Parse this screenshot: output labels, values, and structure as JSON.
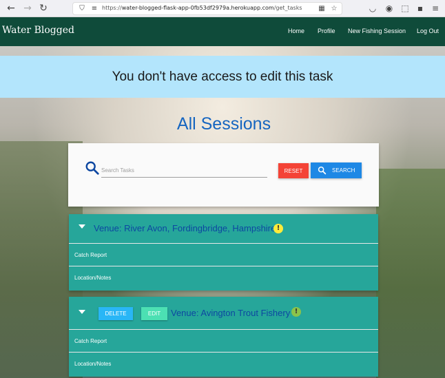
{
  "browser": {
    "url_prefix": "https://",
    "url_host": "water-blogged-flask-app-0fb53df2979a.herokuapp.com",
    "url_path": "/get_tasks"
  },
  "navbar": {
    "brand": "Water Blogged",
    "links": [
      "Home",
      "Profile",
      "New Fishing Session",
      "Log Out"
    ]
  },
  "alert": {
    "message": "You don't have access to edit this task"
  },
  "heading": "All Sessions",
  "search": {
    "placeholder": "Search Tasks",
    "reset_label": "RESET",
    "search_label": "SEARCH"
  },
  "sessions": [
    {
      "venue": "Venue: River Avon, Fordingbridge, Hampshire",
      "exclaim": "!",
      "exclaim_color": "#ffeb3b",
      "rows": [
        "Catch Report",
        "Location/Notes"
      ]
    },
    {
      "venue": "Venue: Avington Trout Fishery",
      "exclaim": "!",
      "exclaim_color": "#8bc34a",
      "delete_label": "DELETE",
      "edit_label": "EDIT",
      "rows": [
        "Catch Report",
        "Location/Notes"
      ]
    }
  ],
  "colors": {
    "navbar": "#0f4b3a",
    "alert": "#b3e5fc",
    "heading": "#1565c0",
    "session": "#26a69a",
    "reset": "#f44336",
    "search": "#1e88e5"
  }
}
